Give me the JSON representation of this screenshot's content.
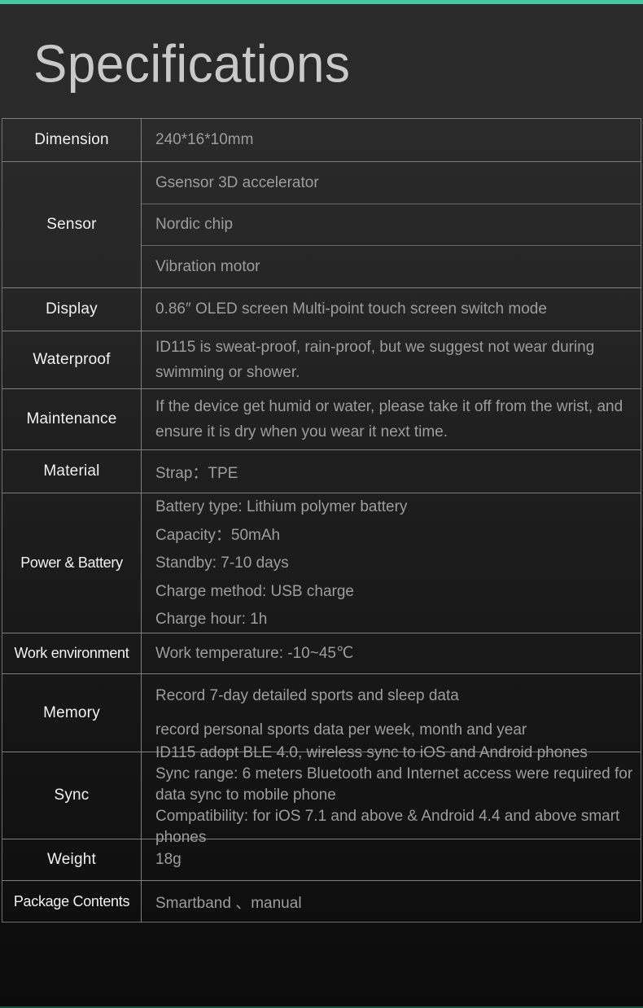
{
  "theme": {
    "accent_top": "#44c9a0",
    "accent_bottom": "#14503f",
    "label_text": "#f2f2f2",
    "value_text": "#9d9d9d",
    "title_text": "#c9c9c9",
    "border": "#7e7e7e"
  },
  "header": {
    "title": "Specifications"
  },
  "table": {
    "rows": [
      {
        "label": "Dimension",
        "lines": [
          "240*16*10mm"
        ]
      },
      {
        "label": "Sensor",
        "lines": [
          "Gsensor 3D accelerator",
          "Nordic chip",
          "Vibration motor"
        ]
      },
      {
        "label": "Display",
        "lines": [
          "0.86″ OLED screen Multi-point touch screen switch mode"
        ]
      },
      {
        "label": "Waterproof",
        "lines": [
          "ID115 is sweat-proof, rain-proof, but we suggest not wear during swimming or shower."
        ]
      },
      {
        "label": "Maintenance",
        "lines": [
          "If the device get humid or water, please take it off from the wrist, and ensure it is dry when you wear it next time."
        ]
      },
      {
        "label": "Material",
        "lines": [
          "Strap：TPE"
        ]
      },
      {
        "label": "Power & Battery",
        "lines": [
          "Battery type: Lithium polymer battery",
          "Capacity：50mAh",
          "Standby: 7-10 days",
          "Charge method: USB charge",
          "Charge hour: 1h"
        ]
      },
      {
        "label": "Work environment",
        "lines": [
          "Work temperature: -10~45℃"
        ]
      },
      {
        "label": "Memory",
        "lines": [
          "Record 7-day detailed sports and sleep data",
          "record personal sports data per week, month and year"
        ]
      },
      {
        "label": "Sync",
        "lines": [
          "ID115 adopt BLE 4.0, wireless sync to iOS and Android phones",
          "Sync range: 6 meters Bluetooth and Internet access were required for data sync to mobile phone",
          "Compatibility: for iOS 7.1 and above & Android 4.4 and above smart phones"
        ]
      },
      {
        "label": "Weight",
        "lines": [
          "18g"
        ]
      },
      {
        "label": "Package Contents",
        "lines": [
          "Smartband 、manual"
        ]
      }
    ]
  }
}
